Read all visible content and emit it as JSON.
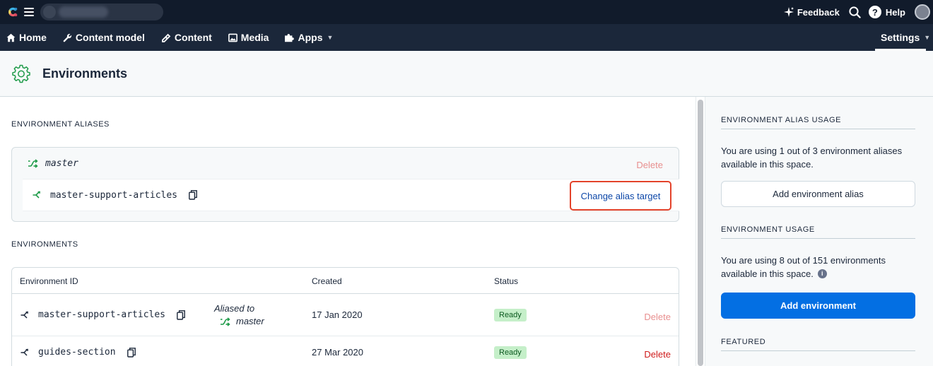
{
  "topbar": {
    "feedback_label": "Feedback",
    "help_label": "Help"
  },
  "nav": {
    "home": "Home",
    "content_model": "Content model",
    "content": "Content",
    "media": "Media",
    "apps": "Apps",
    "settings": "Settings"
  },
  "page": {
    "title": "Environments"
  },
  "aliases": {
    "section_label": "ENVIRONMENT ALIASES",
    "alias_name": "master",
    "delete_label": "Delete",
    "target_env": "master-support-articles",
    "change_label": "Change alias target"
  },
  "environments": {
    "section_label": "ENVIRONMENTS",
    "columns": [
      "Environment ID",
      "Created",
      "Status"
    ],
    "rows": [
      {
        "id": "master-support-articles",
        "aliased_label": "Aliased to",
        "aliased_target": "master",
        "created": "17 Jan 2020",
        "status": "Ready",
        "delete_label": "Delete"
      },
      {
        "id": "guides-section",
        "created": "27 Mar 2020",
        "status": "Ready",
        "delete_label": "Delete"
      }
    ]
  },
  "sidebar": {
    "alias_usage_label": "ENVIRONMENT ALIAS USAGE",
    "alias_usage_text": "You are using 1 out of 3 environment aliases available in this space.",
    "add_alias_label": "Add environment alias",
    "env_usage_label": "ENVIRONMENT USAGE",
    "env_usage_text": "You are using 8 out of 151 environments available in this space.",
    "add_env_label": "Add environment",
    "featured_label": "FEATURED"
  },
  "colors": {
    "topbar": "#111b2b",
    "navbar": "#1b273a",
    "primary": "#036fe3",
    "alias_green": "#1f9b49",
    "danger": "#cf1a1a",
    "danger_muted": "#e88f8f",
    "highlight": "#e3432b"
  },
  "icons": [
    "contentful-logo-icon",
    "hamburger-icon",
    "sparkle-icon",
    "search-icon",
    "help-icon",
    "home-icon",
    "wrench-icon",
    "pen-icon",
    "image-icon",
    "puzzle-icon",
    "gear-icon",
    "alias-icon",
    "branch-icon",
    "copy-icon",
    "info-icon"
  ]
}
